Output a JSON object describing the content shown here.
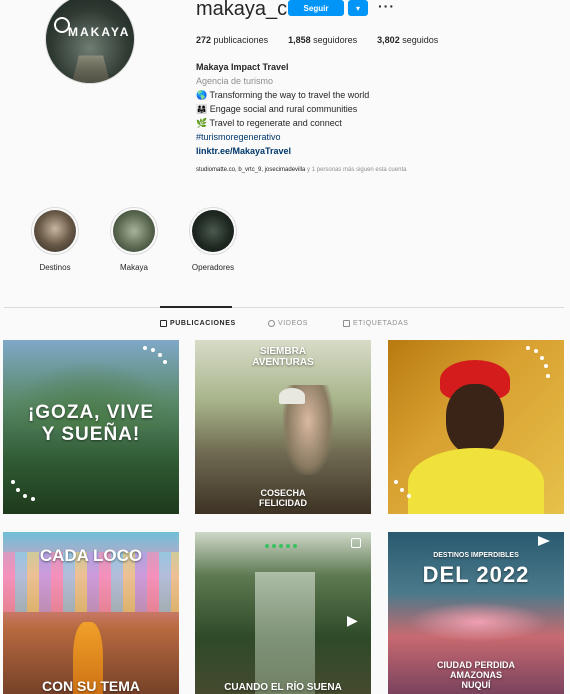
{
  "profile": {
    "username": "makaya_col",
    "follow_label": "Seguir",
    "avatar_logo": "MAKAYA",
    "stats": [
      {
        "value": "272",
        "label": "publicaciones"
      },
      {
        "value": "1,858",
        "label": "seguidores"
      },
      {
        "value": "3,802",
        "label": "seguidos"
      }
    ],
    "bio": {
      "name": "Makaya Impact Travel",
      "category": "Agencia de turismo",
      "lines": [
        "🌎 Transforming the way to travel the world",
        "👨‍👩‍👧 Engage social and rural communities",
        "🌿 Travel to regenerate and connect"
      ],
      "hashtag": "#turismoregenerativo",
      "link": "linktr.ee/MakayaTravel"
    },
    "followed_by_names": "studiomatte.co, b_vrtc_9, josecimadevilla",
    "followed_by_suffix": " y 1 personas más siguen esta cuenta"
  },
  "highlights": [
    {
      "label": "Destinos"
    },
    {
      "label": "Makaya"
    },
    {
      "label": "Operadores"
    }
  ],
  "tabs": [
    {
      "label": "PUBLICACIONES",
      "active": true
    },
    {
      "label": "VIDEOS",
      "active": false
    },
    {
      "label": "ETIQUETADAS",
      "active": false
    }
  ],
  "posts": [
    {
      "caption": "¡GOZA, VIVE\nY SUEÑA!"
    },
    {
      "caption_top": "SIEMBRA\nAVENTURAS",
      "caption_bottom": "COSECHA\nFELICIDAD"
    },
    {
      "caption": ""
    },
    {
      "caption_top": "CADA LOCO",
      "caption_bottom": "CON SU TEMA"
    },
    {
      "caption_bottom": "CUANDO EL RÍO SUENA"
    },
    {
      "caption_small": "DESTINOS IMPERDIBLES",
      "caption_top": "DEL 2022",
      "caption_bottom": "CIUDAD PERDIDA\nAMAZONAS\nNUQUÍ"
    }
  ],
  "colors": {
    "accent": "#0095f6",
    "link": "#00376b",
    "muted": "#8e8e8e"
  }
}
